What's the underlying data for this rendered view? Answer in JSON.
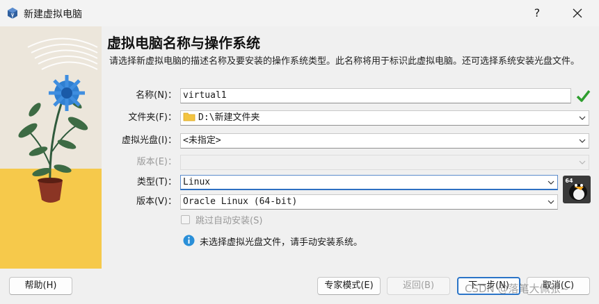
{
  "window": {
    "title": "新建虚拟电脑",
    "help_label": "?"
  },
  "page": {
    "heading": "虚拟电脑名称与操作系统",
    "description": "请选择新虚拟电脑的描述名称及要安装的操作系统类型。此名称将用于标识此虚拟电脑。还可选择系统安装光盘文件。"
  },
  "form": {
    "name": {
      "label": "名称(N)：",
      "value": "virtual1"
    },
    "folder": {
      "label": "文件夹(F)：",
      "value": "D:\\新建文件夹"
    },
    "iso": {
      "label": "虚拟光盘(I)：",
      "value": "<未指定>"
    },
    "edition": {
      "label": "版本(E)：",
      "value": ""
    },
    "type": {
      "label": "类型(T)：",
      "value": "Linux"
    },
    "version": {
      "label": "版本(V)：",
      "value": "Oracle Linux (64-bit)"
    },
    "skip_unattended": {
      "label": "跳过自动安装(S)",
      "checked": false
    },
    "info": "未选择虚拟光盘文件，请手动安装系统。",
    "os_badge": "64"
  },
  "buttons": {
    "help": "帮助(H)",
    "expert": "专家模式(E)",
    "back": "返回(B)",
    "next": "下一步(N)",
    "cancel": "取消(C)"
  },
  "watermark": "CSDN @落笔大佩张~",
  "colors": {
    "accent": "#2a74c7",
    "ok": "#2e9e2e",
    "art_bg": "#ede7dc",
    "art_floor": "#f5c84a"
  }
}
